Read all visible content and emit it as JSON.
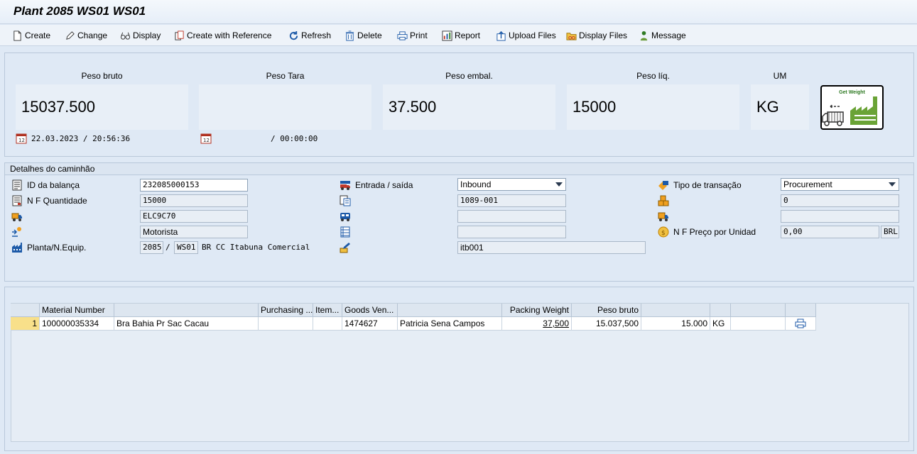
{
  "window": {
    "title": "Plant 2085  WS01 WS01"
  },
  "toolbar": {
    "create": "Create",
    "change": "Change",
    "display": "Display",
    "create_ref": "Create with Reference",
    "refresh": "Refresh",
    "delete": "Delete",
    "print": "Print",
    "report": "Report",
    "upload": "Upload Files",
    "display_files": "Display Files",
    "message": "Message"
  },
  "weights": {
    "bruto_label": "Peso bruto",
    "bruto_value": "15037.500",
    "tara_label": "Peso Tara",
    "tara_value": "",
    "embal_label": "Peso embal.",
    "embal_value": "37.500",
    "liq_label": "Peso líq.",
    "liq_value": "15000",
    "um_label": "UM",
    "um_value": "KG",
    "datetime1": "22.03.2023 / 20:56:36",
    "datetime2": "/ 00:00:00",
    "get_weight": "Get Weight"
  },
  "truck": {
    "section_title": "Detalhes do caminhão",
    "id_label": "ID da balança",
    "id_value": "232085000153",
    "nf_qty_label": "N F Quantidade",
    "nf_qty_value": "15000",
    "plate_value": "ELC9C70",
    "driver_value": "Motorista",
    "plant_label": "Planta/N.Equip.",
    "plant_value": "2085",
    "slash": "/",
    "ws_value": "WS01",
    "plant_desc": "BR CC Itabuna Comercial",
    "direction_label": "Entrada / saída",
    "direction_value": "Inbound",
    "doc_value": "1089-001",
    "user_value": "itb001",
    "trans_label": "Tipo de transação",
    "trans_value": "Procurement",
    "count_value": "0",
    "price_label": "N F Preço por Unidad",
    "price_value": "0,00",
    "currency": "BRL"
  },
  "table": {
    "headers": [
      "Material Number",
      "",
      "Purchasing ...",
      "Item...",
      "Goods Ven...",
      "",
      "Packing Weight",
      "Peso bruto",
      "",
      "",
      "",
      ""
    ],
    "rows": [
      {
        "num": "1",
        "material": "100000035334",
        "desc": "Bra Bahia  Pr Sac Cacau",
        "purchasing": "",
        "item": "",
        "vendor": "1474627",
        "vendor_name": "Patricia Sena Campos",
        "packing": "37,500",
        "bruto": "15.037,500",
        "liq": "15.000",
        "unit": "KG",
        "extra": "",
        "print_icon": "printer-icon"
      }
    ]
  }
}
